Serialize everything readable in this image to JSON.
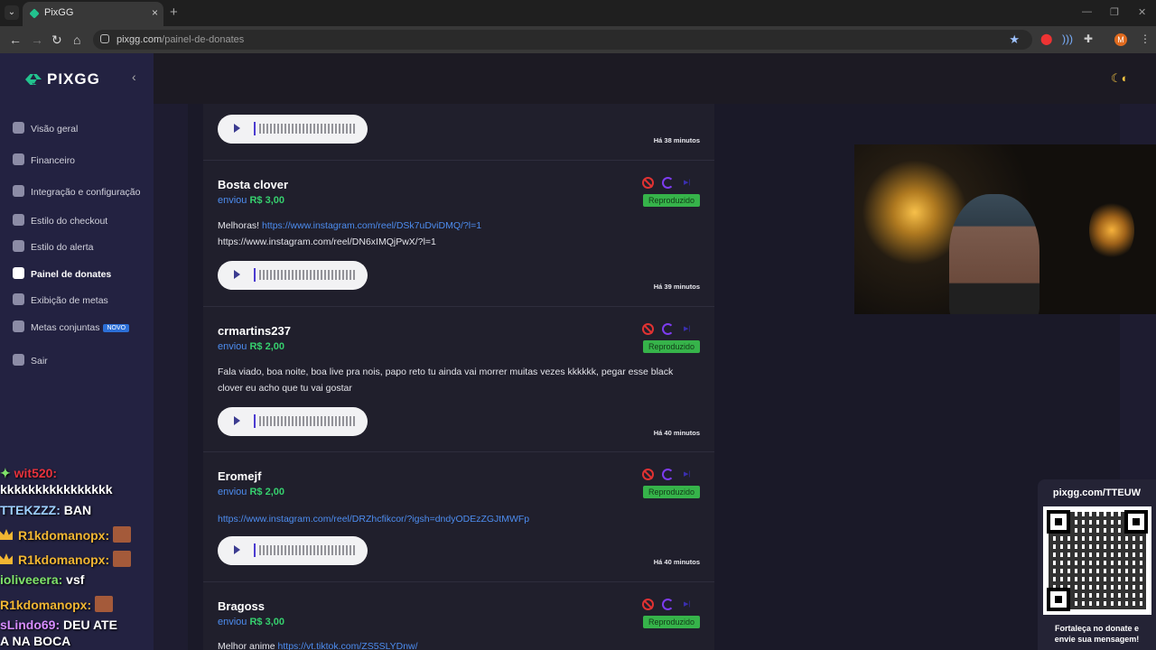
{
  "browser": {
    "tab_title": "PixGG",
    "url_host": "pixgg.com",
    "url_path": "/painel-de-donates",
    "profile_initial": "M"
  },
  "sidebar": {
    "logo": "PIXGG",
    "items": [
      {
        "label": "Visão geral",
        "icon": "home-icon"
      },
      {
        "label": "Financeiro",
        "icon": "wallet-icon"
      },
      {
        "label": "Integração e configuração",
        "icon": "document-icon"
      },
      {
        "label": "Estilo do checkout",
        "icon": "palette-icon"
      },
      {
        "label": "Estilo do alerta",
        "icon": "palette-icon"
      },
      {
        "label": "Painel de donates",
        "icon": "hand-coin-icon"
      },
      {
        "label": "Exibição de metas",
        "icon": "star-icon"
      },
      {
        "label": "Metas conjuntas",
        "icon": "rocket-icon",
        "badge": "NOVO"
      },
      {
        "label": "Sair",
        "icon": "logout-icon"
      }
    ]
  },
  "donations": [
    {
      "time": "Há 38 minutos"
    },
    {
      "name": "Bosta clover",
      "sent": "enviou",
      "amount": "R$ 3,00",
      "status": "Reproduzido",
      "msg_prefix": "Melhoras! ",
      "msg_link": "https://www.instagram.com/reel/DSk7uDviDMQ/?l=1",
      "msg_line2": "https://www.instagram.com/reel/DN6xIMQjPwX/?l=1",
      "time": "Há 39 minutos"
    },
    {
      "name": "crmartins237",
      "sent": "enviou",
      "amount": "R$ 2,00",
      "status": "Reproduzido",
      "msg": "Fala viado, boa noite, boa live pra nois, papo reto tu ainda vai morrer muitas vezes kkkkkk, pegar esse black clover eu acho que tu vai gostar",
      "time": "Há 40 minutos"
    },
    {
      "name": "Eromejf",
      "sent": "enviou",
      "amount": "R$ 2,00",
      "status": "Reproduzido",
      "msg_link": "https://www.instagram.com/reel/DRZhcfikcor/?igsh=dndyODEzZGJtMWFp",
      "time": "Há 40 minutos"
    },
    {
      "name": "Bragoss",
      "sent": "enviou",
      "amount": "R$ 3,00",
      "status": "Reproduzido",
      "msg_prefix": "Melhor anime ",
      "msg_link": "https://vt.tiktok.com/ZS5SLYDnw/"
    }
  ],
  "chat": [
    {
      "user": "wit520:",
      "text": "",
      "color": "#e8323c"
    },
    {
      "user": "",
      "text": "kkkkkkkkkkkkkkkk",
      "color": "#ffffff"
    },
    {
      "user": "TTEKZZZ:",
      "text": "BAN",
      "color": "#9ed0ff"
    },
    {
      "user": "R1kdomanopx:",
      "text": "",
      "color": "#f2b632"
    },
    {
      "user": "R1kdomanopx:",
      "text": "",
      "color": "#f2b632"
    },
    {
      "user": "ioliveeera:",
      "text": "vsf",
      "color": "#7fe36a"
    },
    {
      "user": "R1kdomanopx:",
      "text": "",
      "color": "#f2b632"
    },
    {
      "user": "sLindo69:",
      "text": "DEU ATE",
      "color": "#d68cff"
    },
    {
      "user": "",
      "text": "A NA BOCA",
      "color": "#ffffff"
    }
  ],
  "overlay": {
    "qr_url": "pixgg.com/TTEUW",
    "qr_caption_line1": "Fortaleça no donate e",
    "qr_caption_line2": "envie sua mensagem!"
  },
  "colors": {
    "brand_green": "#22c38e",
    "sidebar_bg": "#232241",
    "amount_green": "#36d06e",
    "link_blue": "#4d8df0",
    "status_green": "#36b34a"
  }
}
